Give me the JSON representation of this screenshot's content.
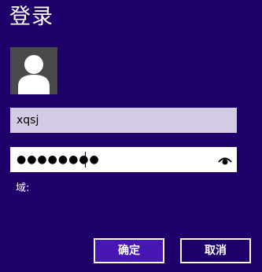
{
  "dialog": {
    "title": "登录"
  },
  "user": {
    "avatar_icon": "user-silhouette-icon"
  },
  "form": {
    "username_value": "xqsj",
    "password_masked": "●●●●●●●●",
    "reveal_icon": "eye-icon",
    "domain_label": "域:"
  },
  "buttons": {
    "ok_label": "确定",
    "cancel_label": "取消"
  },
  "colors": {
    "background": "#1f006b",
    "username_field": "#d3cbe4",
    "ok_button": "#4617b4",
    "avatar_bg": "#4a4a4a"
  }
}
